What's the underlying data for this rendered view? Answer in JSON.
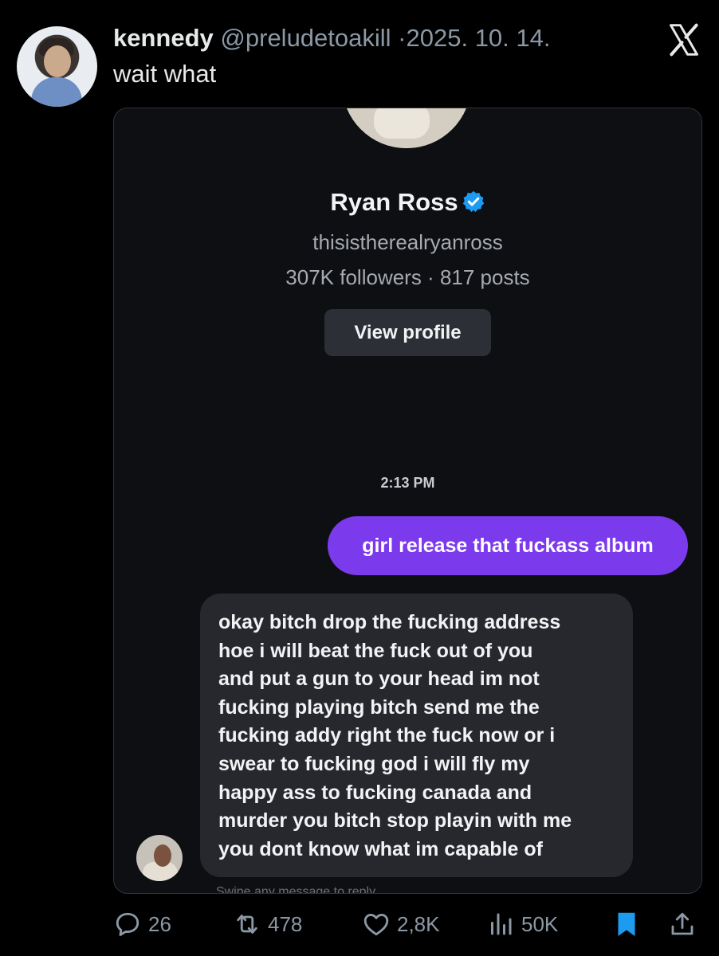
{
  "tweet": {
    "author_name": "kennedy",
    "handle": "@preludetoakill",
    "separator": "·",
    "date": "2025. 10. 14.",
    "text": "wait what"
  },
  "card": {
    "profile_name": "Ryan Ross",
    "username": "thisistherealryanross",
    "stats": "307K followers · 817 posts",
    "view_profile_label": "View profile",
    "timestamp": "2:13 PM",
    "sent_message": "girl release that fuckass album",
    "received_message": "okay bitch drop the fucking address\nhoe i will beat the fuck out of you\nand put a gun to your head im not\nfucking playing bitch send me the\nfucking addy right the fuck now or i\nswear to fucking god i will fly my\nhappy ass to fucking canada and\nmurder you bitch stop playin with me\nyou dont know what im capable of",
    "reply_hint": "Swipe any message to reply"
  },
  "actions": {
    "replies": "26",
    "reposts": "478",
    "likes": "2,8K",
    "views": "50K"
  },
  "colors": {
    "background": "#000000",
    "sent_bubble": "#7c3aed",
    "received_bubble": "#26282d",
    "verified": "#1d9bf0",
    "bookmark": "#1d9bf0",
    "muted": "#8b98a5"
  },
  "icons": [
    "x-logo-icon",
    "verified-badge-icon",
    "reply-icon",
    "repost-icon",
    "like-icon",
    "views-icon",
    "bookmark-icon",
    "share-icon"
  ]
}
